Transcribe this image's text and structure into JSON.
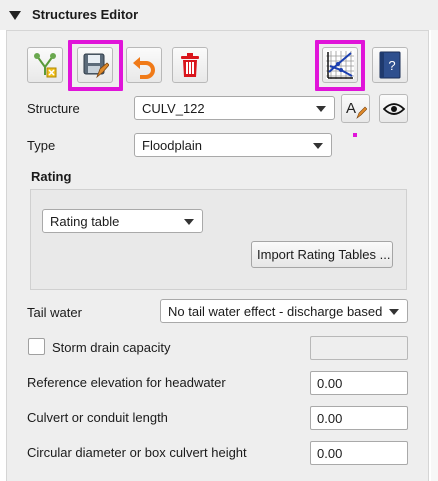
{
  "header": {
    "title": "Structures Editor"
  },
  "toolbar": {
    "icons": [
      "schematize-icon",
      "save-icon",
      "undo-icon",
      "delete-icon",
      "rating-plot-icon",
      "help-icon"
    ]
  },
  "structure": {
    "label": "Structure",
    "value": "CULV_122"
  },
  "type": {
    "label": "Type",
    "value": "Floodplain"
  },
  "rating": {
    "title": "Rating",
    "mode": "Rating table",
    "import_label": "Import Rating Tables ..."
  },
  "tail_water": {
    "label": "Tail water",
    "value": "No tail water effect - discharge based c"
  },
  "storm_drain": {
    "label": "Storm drain capacity",
    "value": ""
  },
  "reference_elevation": {
    "label": "Reference elevation for headwater",
    "value": "0.00"
  },
  "culvert_length": {
    "label": "Culvert or conduit length",
    "value": "0.00"
  },
  "diameter": {
    "label": "Circular diameter or box culvert height",
    "value": "0.00"
  },
  "colors": {
    "highlight": "#e014d9",
    "panel": "#eeeeee"
  }
}
